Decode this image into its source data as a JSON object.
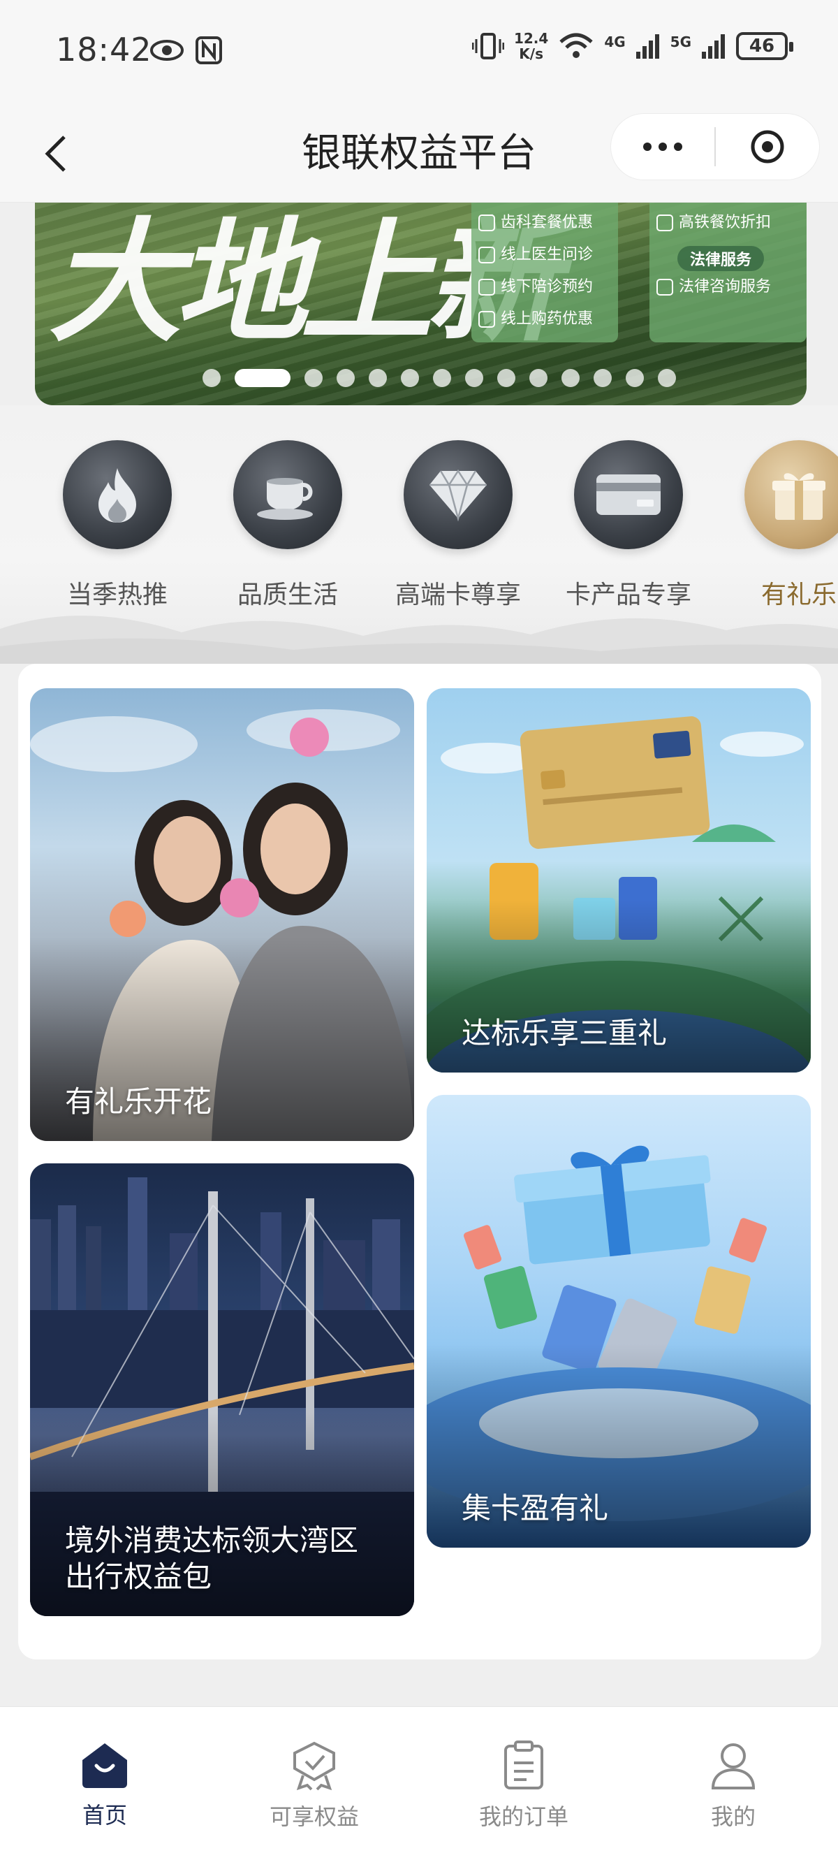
{
  "status_bar": {
    "time": "18:42",
    "net_speed_value": "12.4",
    "net_speed_unit": "K/s",
    "network_a": "4G",
    "network_b": "5G",
    "battery": "46"
  },
  "nav": {
    "title": "银联权益平台"
  },
  "banner": {
    "headline": "大地上新",
    "panel_a": [
      "齿科套餐优惠",
      "线上医生问诊",
      "线下陪诊预约",
      "线上购药优惠"
    ],
    "panel_b_top": "高铁餐饮折扣",
    "panel_b_tag": "法律服务",
    "panel_b_bottom": "法律咨询服务",
    "dot_count": 14,
    "active_dot_index": 1
  },
  "categories": [
    {
      "label": "当季热推",
      "icon": "flame-icon"
    },
    {
      "label": "品质生活",
      "icon": "coffee-cup-icon"
    },
    {
      "label": "高端卡尊享",
      "icon": "diamond-icon"
    },
    {
      "label": "卡产品专享",
      "icon": "card-icon"
    },
    {
      "label": "有礼乐",
      "icon": "gift-icon",
      "active": true
    }
  ],
  "tiles": {
    "t1": "有礼乐开花",
    "t2": "达标乐享三重礼",
    "t3_line1": "境外消费达标领大湾区",
    "t3_line2": "出行权益包",
    "t4": "集卡盈有礼"
  },
  "tab_bar": [
    {
      "label": "首页",
      "icon": "home-icon",
      "active": true
    },
    {
      "label": "可享权益",
      "icon": "benefits-icon"
    },
    {
      "label": "我的订单",
      "icon": "clipboard-icon"
    },
    {
      "label": "我的",
      "icon": "user-icon"
    }
  ],
  "colors": {
    "primary_dark": "#1d2b52",
    "active_category": "#8a6a2e"
  }
}
